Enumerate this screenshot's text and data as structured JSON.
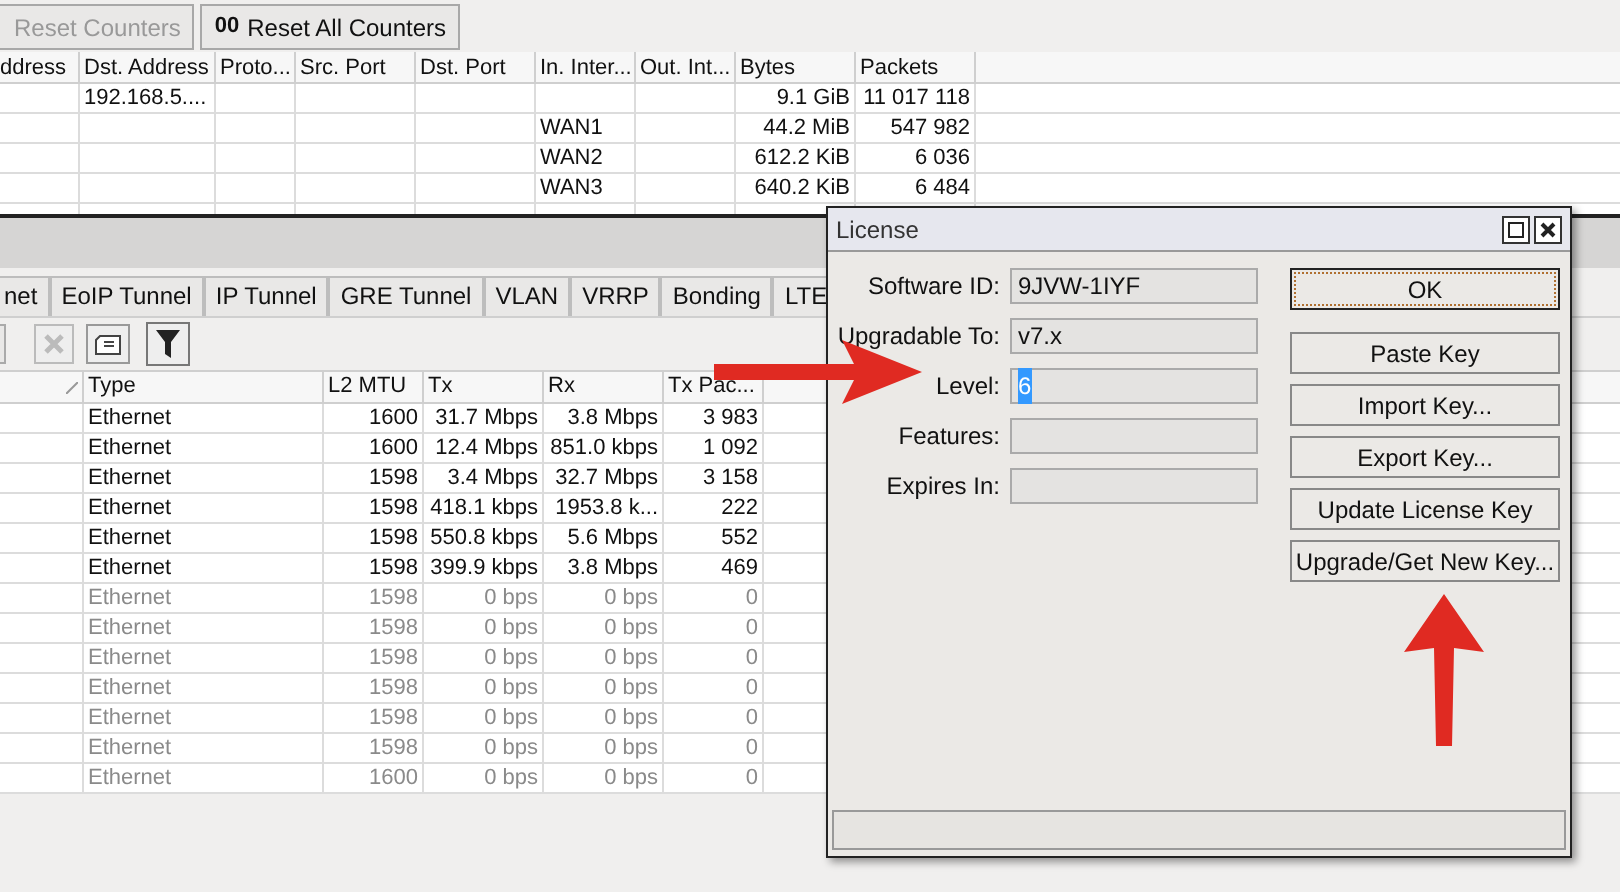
{
  "firewall_window": {
    "toolbar": [
      {
        "label": "Reset Counters",
        "disabled": true
      },
      {
        "prefix": "00",
        "label": "Reset All Counters",
        "disabled": false
      }
    ],
    "table": {
      "columns": [
        "ddress",
        "Dst. Address",
        "Proto...",
        "Src. Port",
        "Dst. Port",
        "In. Inter...",
        "Out. Int...",
        "Bytes",
        "Packets"
      ],
      "rows": [
        [
          null,
          "192.168.5....",
          null,
          null,
          null,
          null,
          null,
          "9.1 GiB",
          "11 017 118"
        ],
        [
          null,
          null,
          null,
          null,
          null,
          "WAN1",
          null,
          "44.2 MiB",
          "547 982"
        ],
        [
          null,
          null,
          null,
          null,
          null,
          "WAN2",
          null,
          "612.2 KiB",
          "6 036"
        ],
        [
          null,
          null,
          null,
          null,
          null,
          "WAN3",
          null,
          "640.2 KiB",
          "6 484"
        ]
      ]
    }
  },
  "interface_window": {
    "tabs": [
      "net",
      "EoIP Tunnel",
      "IP Tunnel",
      "GRE Tunnel",
      "VLAN",
      "VRRP",
      "Bonding",
      "LTE"
    ],
    "table": {
      "sort_indicator": true,
      "columns": [
        "Type",
        "L2 MTU",
        "Tx",
        "Rx",
        "Tx Pac..."
      ],
      "rows": [
        {
          "cells": [
            "Ethernet",
            "1600",
            "31.7 Mbps",
            "3.8 Mbps",
            "3 983"
          ],
          "disabled": false
        },
        {
          "cells": [
            "Ethernet",
            "1600",
            "12.4 Mbps",
            "851.0 kbps",
            "1 092"
          ],
          "disabled": false
        },
        {
          "cells": [
            "Ethernet",
            "1598",
            "3.4 Mbps",
            "32.7 Mbps",
            "3 158"
          ],
          "disabled": false
        },
        {
          "cells": [
            "Ethernet",
            "1598",
            "418.1 kbps",
            "1953.8 k...",
            "222"
          ],
          "disabled": false
        },
        {
          "cells": [
            "Ethernet",
            "1598",
            "550.8 kbps",
            "5.6 Mbps",
            "552"
          ],
          "disabled": false
        },
        {
          "cells": [
            "Ethernet",
            "1598",
            "399.9 kbps",
            "3.8 Mbps",
            "469"
          ],
          "disabled": false
        },
        {
          "cells": [
            "Ethernet",
            "1598",
            "0 bps",
            "0 bps",
            "0"
          ],
          "disabled": true
        },
        {
          "cells": [
            "Ethernet",
            "1598",
            "0 bps",
            "0 bps",
            "0"
          ],
          "disabled": true
        },
        {
          "cells": [
            "Ethernet",
            "1598",
            "0 bps",
            "0 bps",
            "0"
          ],
          "disabled": true
        },
        {
          "cells": [
            "Ethernet",
            "1598",
            "0 bps",
            "0 bps",
            "0"
          ],
          "disabled": true
        },
        {
          "cells": [
            "Ethernet",
            "1598",
            "0 bps",
            "0 bps",
            "0"
          ],
          "disabled": true
        },
        {
          "cells": [
            "Ethernet",
            "1598",
            "0 bps",
            "0 bps",
            "0"
          ],
          "disabled": true
        },
        {
          "cells": [
            "Ethernet",
            "1600",
            "0 bps",
            "0 bps",
            "0"
          ],
          "disabled": true
        }
      ]
    }
  },
  "license_dialog": {
    "title": "License",
    "fields": [
      {
        "label": "Software ID:",
        "value": "9JVW-1IYF"
      },
      {
        "label": "Upgradable To:",
        "value": "v7.x"
      },
      {
        "label": "Level:",
        "value": "6",
        "highlighted": true
      },
      {
        "label": "Features:"
      },
      {
        "label": "Expires In:"
      }
    ],
    "buttons": [
      {
        "label": "OK",
        "focused": true
      },
      {
        "label": "Paste Key",
        "focused": false
      },
      {
        "label": "Import Key...",
        "focused": false
      },
      {
        "label": "Export Key...",
        "focused": false
      },
      {
        "label": "Update License Key",
        "focused": false
      },
      {
        "label": "Upgrade/Get New Key...",
        "focused": false
      }
    ]
  }
}
